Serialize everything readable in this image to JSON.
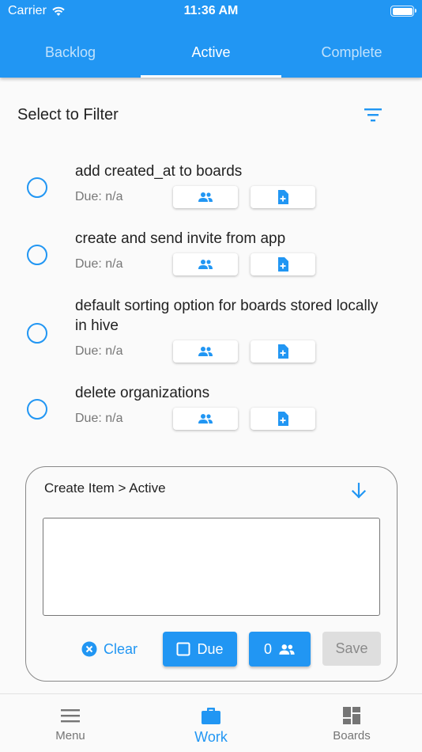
{
  "status_bar": {
    "carrier": "Carrier",
    "time": "11:36 AM"
  },
  "tabs": [
    {
      "label": "Backlog",
      "active": false
    },
    {
      "label": "Active",
      "active": true
    },
    {
      "label": "Complete",
      "active": false
    }
  ],
  "filter": {
    "label": "Select to Filter",
    "icon": "filter-icon"
  },
  "items": [
    {
      "title": "add created_at to boards",
      "due": "Due: n/a"
    },
    {
      "title": "create and send invite from app",
      "due": "Due: n/a"
    },
    {
      "title": "default sorting option for boards stored locally in hive",
      "due": "Due: n/a"
    },
    {
      "title": "delete organizations",
      "due": "Due: n/a"
    }
  ],
  "create_panel": {
    "title": "Create Item > Active",
    "input_value": "",
    "clear_label": "Clear",
    "due_label": "Due",
    "assignee_count": "0",
    "save_label": "Save"
  },
  "bottom_nav": [
    {
      "label": "Menu",
      "icon": "menu-icon",
      "active": false
    },
    {
      "label": "Work",
      "icon": "briefcase-icon",
      "active": true
    },
    {
      "label": "Boards",
      "icon": "dashboard-icon",
      "active": false
    }
  ],
  "colors": {
    "primary": "#2196f3",
    "background": "#fafafa",
    "disabled": "#dedede"
  }
}
